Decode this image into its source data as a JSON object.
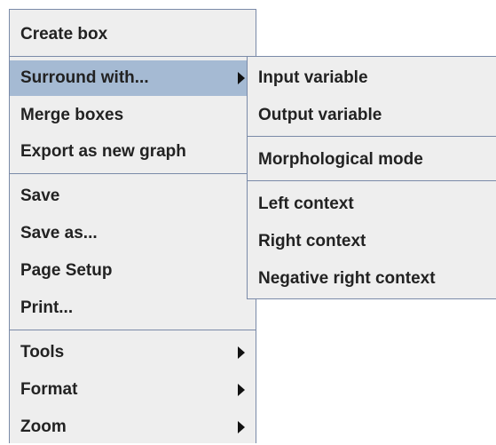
{
  "main_menu": {
    "create_box": "Create box",
    "surround_with": "Surround with...",
    "merge_boxes": "Merge boxes",
    "export_as_new_graph": "Export as new graph",
    "save": "Save",
    "save_as": "Save as...",
    "page_setup": "Page Setup",
    "print": "Print...",
    "tools": "Tools",
    "format": "Format",
    "zoom": "Zoom"
  },
  "submenu": {
    "input_variable": "Input variable",
    "output_variable": "Output variable",
    "morphological_mode": "Morphological mode",
    "left_context": "Left context",
    "right_context": "Right context",
    "negative_right_context": "Negative right context"
  },
  "icons": {
    "submenu_arrow": "chevron-right-icon"
  },
  "colors": {
    "menu_background": "#eeeeee",
    "highlight": "#a5bad3",
    "border": "#7a8aa8",
    "text": "#222222"
  }
}
